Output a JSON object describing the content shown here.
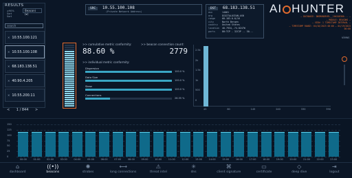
{
  "results": {
    "title": "RESULTS",
    "filter_labels": [
      "≥90%",
      "Sort",
      "Sort"
    ],
    "count_select": "Beaconi (▾)",
    "search_placeholder": "search",
    "items": [
      {
        "ip": "10.55.100.121"
      },
      {
        "ip": "10.55.100.108"
      },
      {
        "ip": "68.183.138.51"
      },
      {
        "ip": "40.90.4.205"
      },
      {
        "ip": "10.55.200.11"
      }
    ],
    "page_label": "1 / 844"
  },
  "header": {
    "src_label": "SRC",
    "src_ip": "10.55.100.108",
    "src_sub": "(Private Network Address)",
    "dst_label": "DST",
    "dst_ip": "68.183.138.51",
    "dst_fields": [
      {
        "k": "asn",
        "v": "14061"
      },
      {
        "k": "org",
        "v": "DIGITALOCEAN-ASN"
      },
      {
        "k": "range",
        "v": "68.183.0.0/16"
      },
      {
        "k": "city",
        "v": "North Bergen"
      },
      {
        "k": "country",
        "v": "United States"
      },
      {
        "k": "location",
        "v": "40.7934,-74.0247W"
      },
      {
        "k": "ports",
        "v": "80:TCP - 32C3P -- 50..."
      }
    ]
  },
  "brand": {
    "logo_left": "AI",
    "logo_right": "HUNTER",
    "notes": [
      "— DATABASE: DNSMONDEVEL__104348366... —",
      "— MODULE: BEACONS —",
      "— VIEW: 1 TIMESTAMP INTERVAL —",
      "— TIMESTAMP RANGE: 04/18/2023 00:00 — 04/19/2023 00:00"
    ],
    "side_label": "views"
  },
  "metrics": {
    "cumulative_label": ">> cumulative metric conformity:",
    "cumulative_value": "88.60 %",
    "beacon_label": ">> beacon connection count:",
    "beacon_value": "2779",
    "individual_label": ">> individual metric conformity:",
    "rows": [
      {
        "label": "Dispersion",
        "pct_text": "100.0 %",
        "value": 1.0
      },
      {
        "label": "Data Size",
        "pct_text": "100.0 %",
        "value": 1.0
      },
      {
        "label": "Skew",
        "pct_text": "100.0 %",
        "value": 1.0
      },
      {
        "label": "Connections",
        "pct_text": "28.55 %",
        "value": 0.2855
      }
    ]
  },
  "hist_chart": {
    "y_ticks": [
      "2.5k",
      "2k",
      "1.5k",
      "1k",
      "500",
      "0"
    ],
    "x_ticks": [
      "45",
      "80",
      "145",
      "240",
      "330",
      "390"
    ]
  },
  "bottom_chart": {
    "y_ticks": [
      "150",
      "125",
      "100",
      "75",
      "50",
      "25",
      "0"
    ],
    "x_ticks": [
      "00:00",
      "01:00",
      "02:00",
      "03:00",
      "04:00",
      "05:00",
      "06:00",
      "07:00",
      "08:00",
      "09:00",
      "10:00",
      "11:00",
      "12:00",
      "13:00",
      "14:00",
      "15:00",
      "16:00",
      "17:00",
      "18:00",
      "19:00",
      "20:00",
      "21:00",
      "22:00",
      "23:00"
    ]
  },
  "chart_data": {
    "type": "bar",
    "categories": [
      "00:00",
      "01:00",
      "02:00",
      "03:00",
      "04:00",
      "05:00",
      "06:00",
      "07:00",
      "08:00",
      "09:00",
      "10:00",
      "11:00",
      "12:00",
      "13:00",
      "14:00",
      "15:00",
      "16:00",
      "17:00",
      "18:00",
      "19:00",
      "20:00",
      "21:00",
      "22:00",
      "23:00"
    ],
    "values": [
      115,
      116,
      116,
      115,
      116,
      116,
      115,
      116,
      116,
      116,
      115,
      116,
      116,
      115,
      116,
      116,
      115,
      116,
      116,
      115,
      116,
      116,
      115,
      116
    ],
    "ylim": [
      0,
      150
    ],
    "grid": true
  },
  "nav": [
    {
      "label": "dashboard",
      "icon": "⌂",
      "icon_name": "home-icon"
    },
    {
      "label": "beacons",
      "icon": "((•))",
      "icon_name": "beacon-icon"
    },
    {
      "label": "strobes",
      "icon": "✺",
      "icon_name": "strobe-icon"
    },
    {
      "label": "long connections",
      "icon": "⟷",
      "icon_name": "long-connection-icon"
    },
    {
      "label": "threat intel",
      "icon": "⚠",
      "icon_name": "warning-icon"
    },
    {
      "label": "dns",
      "icon": "✳",
      "icon_name": "dns-icon"
    },
    {
      "label": "client signature",
      "icon": "⌘",
      "icon_name": "signature-icon"
    },
    {
      "label": "certificate",
      "icon": "▭",
      "icon_name": "certificate-icon"
    },
    {
      "label": "deep dive",
      "icon": "◇",
      "icon_name": "deep-dive-icon"
    },
    {
      "label": "logout",
      "icon": "⇥",
      "icon_name": "logout-icon"
    }
  ],
  "colors": {
    "accent": "#3aa6c4",
    "bar_fill": "#0f6a8a",
    "bar_edge": "#5fd3ef",
    "brand_orange": "#e26b2e"
  }
}
